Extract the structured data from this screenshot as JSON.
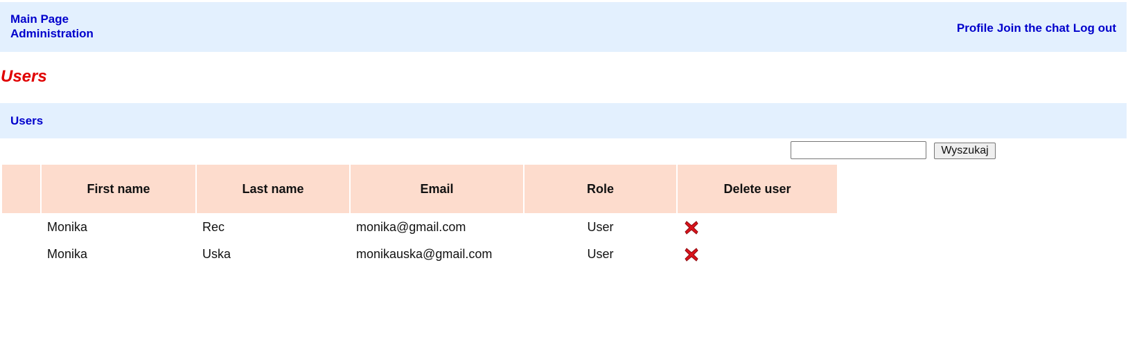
{
  "nav": {
    "main_page": "Main Page",
    "administration": "Administration",
    "profile": "Profile",
    "join_chat": "Join the chat",
    "log_out": "Log out"
  },
  "page": {
    "title": "Users"
  },
  "section": {
    "title": "Users"
  },
  "search": {
    "value": "",
    "button_label": "Wyszukaj"
  },
  "table": {
    "headers": [
      "",
      "First name",
      "Last name",
      "Email",
      "Role",
      "Delete user"
    ],
    "rows": [
      {
        "first_name": "Monika",
        "last_name": "Rec",
        "email": "monika@gmail.com",
        "role": "User",
        "delete_icon": "delete-x-icon"
      },
      {
        "first_name": "Monika",
        "last_name": "Uska",
        "email": "monikauska@gmail.com",
        "role": "User",
        "delete_icon": "delete-x-icon"
      }
    ]
  },
  "colors": {
    "nav_background": "#e3f0fe",
    "link": "#0000cc",
    "title": "#e00000",
    "table_header": "#fddccd",
    "delete_icon": "#d9141c"
  }
}
